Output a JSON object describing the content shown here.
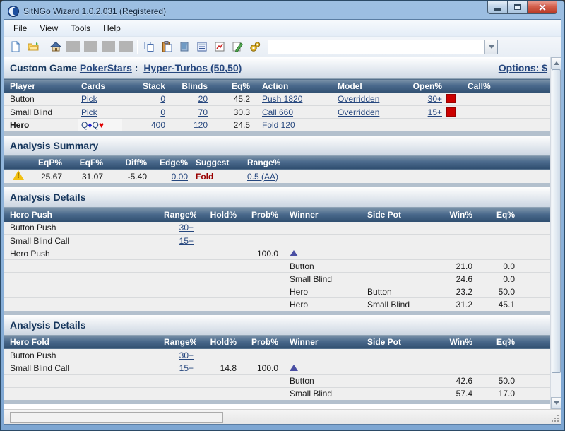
{
  "colors": {
    "link": "#26477e",
    "suggest_fold_red": "#990000",
    "range_swatch_red": "#cc0000",
    "table_header_navy": "#2f4e6f",
    "section_title_navy": "#16365c",
    "diamond_blue": "#2222cc",
    "heart_red": "#e00000",
    "marker_indigo": "#4a4fa3"
  },
  "window": {
    "title": "SitNGo Wizard 1.0.2.031 (Registered)",
    "controls": [
      "minimize",
      "maximize",
      "close"
    ]
  },
  "menu": {
    "items": [
      {
        "label": "File"
      },
      {
        "label": "View"
      },
      {
        "label": "Tools"
      },
      {
        "label": "Help"
      }
    ]
  },
  "toolbar": {
    "icons": [
      "new-document",
      "open-folder",
      "home",
      "disabled",
      "disabled",
      "disabled",
      "disabled",
      "copy",
      "paste",
      "preview",
      "calculator",
      "chart",
      "edit",
      "settings"
    ],
    "combo_value": ""
  },
  "game_header": {
    "prefix": "Custom Game",
    "site_link": "PokerStars",
    "colon": ":",
    "game_link": "Hyper-Turbos (50,50)",
    "options_link": "Options: $"
  },
  "player_table": {
    "headers": {
      "player": "Player",
      "cards": "Cards",
      "stack": "Stack",
      "blinds": "Blinds",
      "eq": "Eq%",
      "action": "Action",
      "model": "Model",
      "open": "Open%",
      "call": "Call%"
    },
    "rows": [
      {
        "player": "Button",
        "cards": "Pick",
        "stack": "0",
        "blinds": "20",
        "eq": "45.2",
        "action": "Push 1820",
        "model": "Overridden",
        "open": "30+"
      },
      {
        "player": "Small Blind",
        "cards": "Pick",
        "stack": "0",
        "blinds": "70",
        "eq": "30.3",
        "action": "Call 660",
        "model": "Overridden",
        "open": "15+"
      },
      {
        "player": "Hero",
        "card1_rank": "Q",
        "card1_suit": "♦",
        "card2_rank": "Q",
        "card2_suit": "♥",
        "stack": "400",
        "blinds": "120",
        "eq": "24.5",
        "action": "Fold 120"
      }
    ]
  },
  "analysis_summary": {
    "title": "Analysis Summary",
    "headers": {
      "eqp": "EqP%",
      "eqf": "EqF%",
      "diff": "Diff%",
      "edge": "Edge%",
      "suggest": "Suggest",
      "range": "Range%"
    },
    "row": {
      "eqp": "25.67",
      "eqf": "31.07",
      "diff": "-5.40",
      "edge": "0.00",
      "suggest": "Fold",
      "range": "0.5 (AA)"
    }
  },
  "hero_push": {
    "section_title": "Analysis Details",
    "label": "Hero Push",
    "headers": {
      "range": "Range%",
      "hold": "Hold%",
      "prob": "Prob%",
      "winner": "Winner",
      "side_pot": "Side Pot",
      "win": "Win%",
      "eq": "Eq%"
    },
    "rows": [
      {
        "name": "Button Push",
        "range": "30+"
      },
      {
        "name": "Small Blind Call",
        "range": "15+"
      },
      {
        "name": "Hero Push",
        "prob": "100.0"
      },
      {
        "winner": "Button",
        "win": "21.0",
        "eq": "0.0"
      },
      {
        "winner": "Small Blind",
        "win": "24.6",
        "eq": "0.0"
      },
      {
        "winner": "Hero",
        "side_pot": "Button",
        "win": "23.2",
        "eq": "50.0"
      },
      {
        "winner": "Hero",
        "side_pot": "Small Blind",
        "win": "31.2",
        "eq": "45.1"
      }
    ]
  },
  "hero_fold": {
    "section_title": "Analysis Details",
    "label": "Hero Fold",
    "headers": {
      "range": "Range%",
      "hold": "Hold%",
      "prob": "Prob%",
      "winner": "Winner",
      "side_pot": "Side Pot",
      "win": "Win%",
      "eq": "Eq%"
    },
    "rows": [
      {
        "name": "Button Push",
        "range": "30+"
      },
      {
        "name": "Small Blind Call",
        "range": "15+",
        "hold": "14.8",
        "prob": "100.0"
      },
      {
        "winner": "Button",
        "win": "42.6",
        "eq": "50.0"
      },
      {
        "winner": "Small Blind",
        "win": "57.4",
        "eq": "17.0"
      }
    ]
  }
}
